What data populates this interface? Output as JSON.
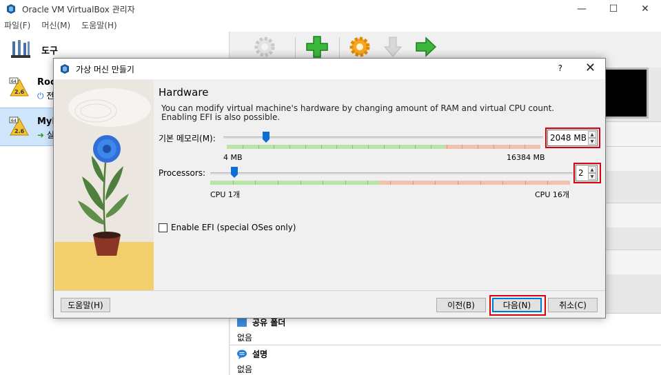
{
  "window": {
    "title": "Oracle VM VirtualBox 관리자"
  },
  "menubar": {
    "items": [
      "파일(F)",
      "머신(M)",
      "도움말(H)"
    ]
  },
  "sidebar": {
    "tools_label": "도구",
    "vms": [
      {
        "name": "Roc",
        "state": "전",
        "version": "2.6"
      },
      {
        "name": "MyI",
        "state": "실",
        "version": "2.6"
      }
    ]
  },
  "details": {
    "shared_folders": {
      "title": "공유 폴더",
      "value": "없음"
    },
    "description": {
      "title": "설명",
      "value": "없음"
    }
  },
  "dialog": {
    "title": "가상 머신 만들기",
    "help_glyph": "?",
    "close_glyph": "✕",
    "heading": "Hardware",
    "description": "You can modify virtual machine's hardware by changing amount of RAM and virtual CPU count. Enabling EFI is also possible.",
    "memory": {
      "label": "기본 메모리(M):",
      "value": "2048 MB",
      "min_label": "4 MB",
      "max_label": "16384 MB",
      "value_fraction": 0.125
    },
    "processors": {
      "label": "Processors:",
      "value": "2",
      "min_label": "CPU 1개",
      "max_label": "CPU 16개",
      "value_fraction": 0.067
    },
    "efi": {
      "label": "Enable EFI (special OSes only)",
      "checked": false
    },
    "buttons": {
      "help": "도움말(H)",
      "back": "이전(B)",
      "next": "다음(N)",
      "cancel": "취소(C)"
    }
  },
  "colors": {
    "highlight": "#d9000d",
    "selection": "#cfe5fb",
    "range_ok": "#b8e6a9",
    "range_bad": "#f2c2b1",
    "slider_handle": "#0a6fd6"
  }
}
